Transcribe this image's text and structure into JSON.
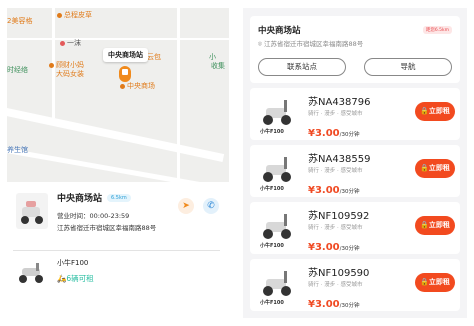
{
  "map": {
    "pois": [
      {
        "label": "总程皮草",
        "color": "orange"
      },
      {
        "label": "2美容格",
        "color": "orange"
      },
      {
        "label": "一沫",
        "color": "gray"
      },
      {
        "label": "中央商场站",
        "color": "gray"
      },
      {
        "label": "云包",
        "color": "orange"
      },
      {
        "label": "小",
        "color": "green"
      },
      {
        "label": "收集",
        "color": "green"
      },
      {
        "label": "时经络",
        "color": "green"
      },
      {
        "label": "顾财小妈",
        "color": "orange"
      },
      {
        "label": "大码女装",
        "color": "orange"
      },
      {
        "label": "中央商场",
        "color": "orange"
      },
      {
        "label": "养生馆",
        "color": "blue"
      }
    ],
    "callout": "中央商场站"
  },
  "station": {
    "name": "中央商场站",
    "distance": "6.5km",
    "hours_label": "营业时间：",
    "hours": "00:00-23:59",
    "address": "江苏省宿迁市宿城区幸福南路88号"
  },
  "model": {
    "name": "小牛F100",
    "available": "6辆可租"
  },
  "detail": {
    "title": "中央商场站",
    "distance": "距您6.5km",
    "address": "江苏省宿迁市宿城区幸福南路88号",
    "contact_label": "联系站点",
    "navigate_label": "导航"
  },
  "vehicles": [
    {
      "plate": "苏NA438796",
      "model": "小牛F100",
      "tags": "骑行 · 漫步 · 感受城市",
      "price": "¥3.00",
      "unit": "/30分钟",
      "rent_label": "立即租"
    },
    {
      "plate": "苏NA438559",
      "model": "小牛F100",
      "tags": "骑行 · 漫步 · 感受城市",
      "price": "¥3.00",
      "unit": "/30分钟",
      "rent_label": "立即租"
    },
    {
      "plate": "苏NF109592",
      "model": "小牛F100",
      "tags": "骑行 · 漫步 · 感受城市",
      "price": "¥3.00",
      "unit": "/30分钟",
      "rent_label": "立即租"
    },
    {
      "plate": "苏NF109590",
      "model": "小牛F100",
      "tags": "骑行 · 漫步 · 感受城市",
      "price": "¥3.00",
      "unit": "/30分钟",
      "rent_label": "立即租"
    }
  ],
  "colors": {
    "accent": "#f24a1f",
    "brand_orange": "#f08a1c",
    "teal": "#2bbfa3"
  }
}
